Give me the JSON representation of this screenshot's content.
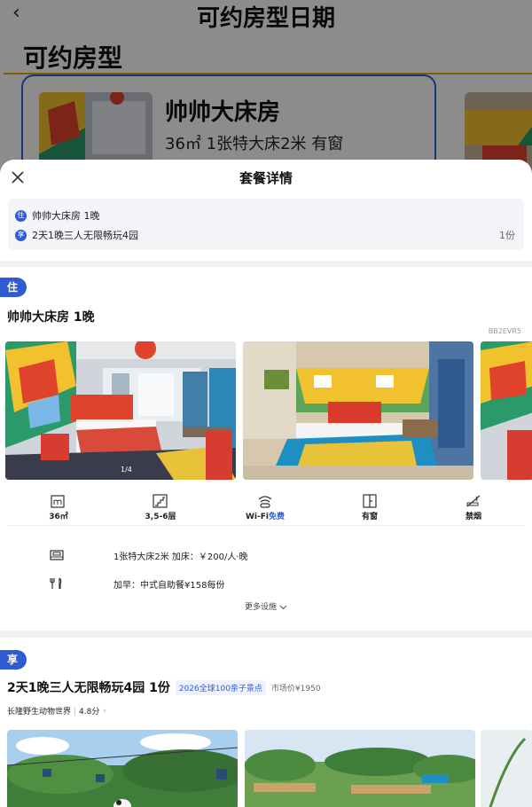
{
  "background": {
    "back_icon": "chevron-left-icon",
    "title": "可约房型日期",
    "section_title": "可约房型",
    "room_card": {
      "name": "帅帅大床房",
      "spec": "36㎡ 1张特大床2米 有窗"
    }
  },
  "sheet": {
    "close_icon": "close-icon",
    "title": "套餐详情",
    "summary": {
      "room_badge": "住",
      "room_text": "帅帅大床房 1晚",
      "enjoy_badge": "享",
      "enjoy_text": "2天1晚三人无限畅玩4园",
      "enjoy_qty": "1份"
    },
    "stay": {
      "tag": "住",
      "room_title": "帅帅大床房 1晚",
      "room_code": "BB2EVR5",
      "photo_indicator": "1/4",
      "features": [
        {
          "icon": "area-icon",
          "label": "36㎡"
        },
        {
          "icon": "stairs-icon",
          "label": "3,5-6层"
        },
        {
          "icon": "wifi-icon",
          "label": "Wi-Fi",
          "highlight": "免费"
        },
        {
          "icon": "window-icon",
          "label": "有窗"
        },
        {
          "icon": "no-smoking-icon",
          "label": "禁烟"
        }
      ],
      "bed_info": "1张特大床2米 加床：￥200/人·晚",
      "breakfast_info": "加早：中式自助餐¥158每份",
      "more_label": "更多设施",
      "more_icon": "chevron-down-icon"
    },
    "enjoy": {
      "tag": "享",
      "package_title": "2天1晚三人无限畅玩4园 1份",
      "package_tag": "2026全球100亲子景点",
      "market_price": "市场价¥1950",
      "venue": "长隆野生动物世界",
      "score": "4.8分"
    }
  },
  "colors": {
    "accent": "#2f5bd3",
    "highlight_border": "#f0a400",
    "separator": "#f0f1f5"
  }
}
